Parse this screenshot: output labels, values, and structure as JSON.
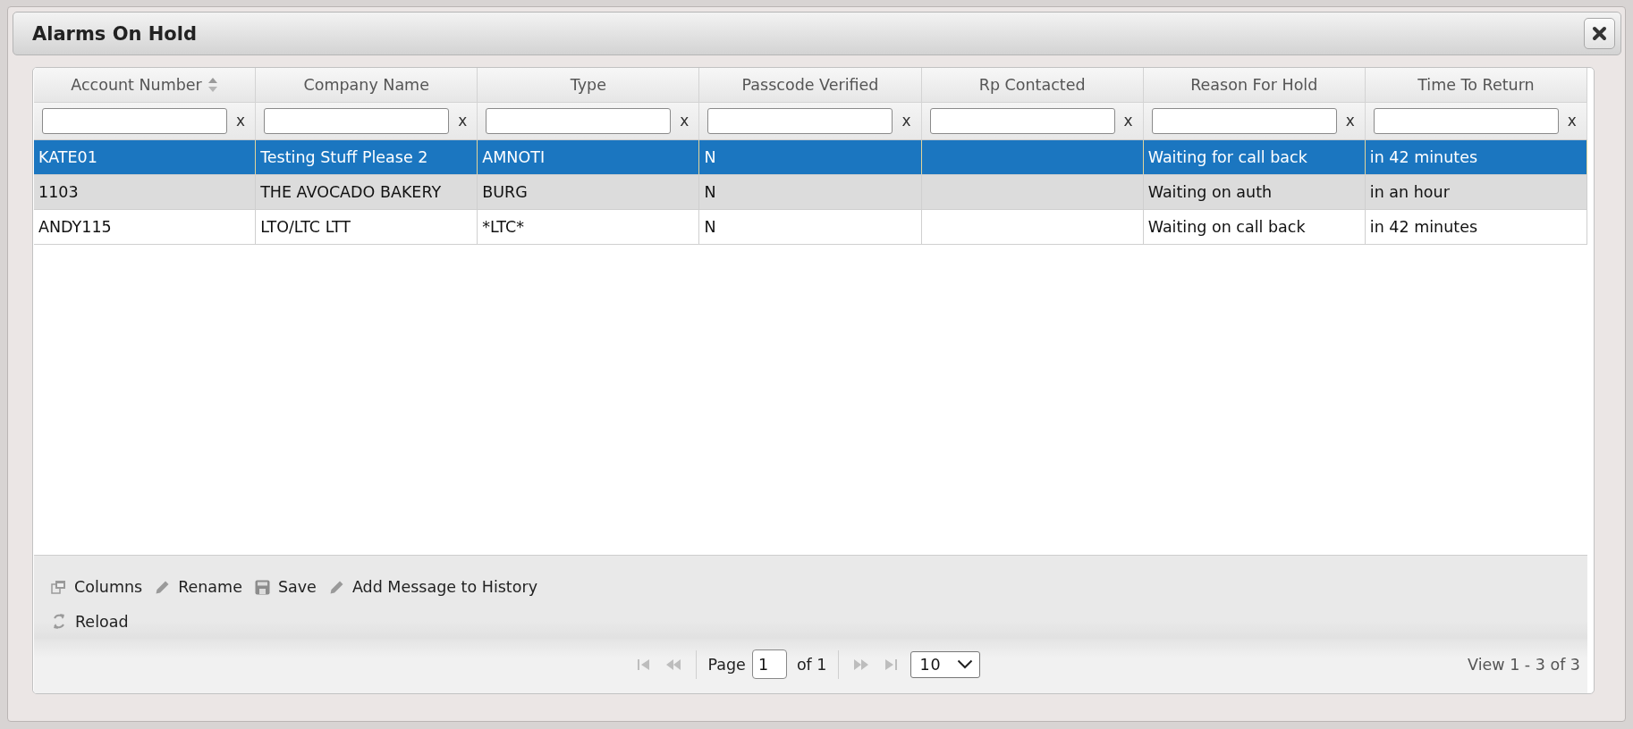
{
  "window": {
    "title": "Alarms On Hold"
  },
  "table": {
    "columns": [
      {
        "label": "Account Number",
        "sorted": true
      },
      {
        "label": "Company Name",
        "sorted": false
      },
      {
        "label": "Type",
        "sorted": false
      },
      {
        "label": "Passcode Verified",
        "sorted": false
      },
      {
        "label": "Rp Contacted",
        "sorted": false
      },
      {
        "label": "Reason For Hold",
        "sorted": false
      },
      {
        "label": "Time To Return",
        "sorted": false
      }
    ],
    "filters": [
      {
        "clear": "x"
      },
      {
        "clear": "x"
      },
      {
        "clear": "x"
      },
      {
        "clear": "x"
      },
      {
        "clear": "x"
      },
      {
        "clear": "x"
      },
      {
        "clear": "x"
      }
    ],
    "rows": [
      {
        "selected": true,
        "highlighted": false,
        "cells": [
          "KATE01",
          "Testing Stuff Please 2",
          "AMNOTI",
          "N",
          null,
          "Waiting for call back",
          "in 42 minutes"
        ]
      },
      {
        "selected": false,
        "highlighted": true,
        "cells": [
          "1103",
          "THE AVOCADO BAKERY",
          "BURG",
          "N",
          null,
          "Waiting on auth",
          "in an hour"
        ]
      },
      {
        "selected": false,
        "highlighted": false,
        "cells": [
          "ANDY115",
          "LTO/LTC LTT",
          "*LTC*",
          "N",
          null,
          "Waiting on call back",
          "in 42 minutes"
        ]
      }
    ]
  },
  "toolbar": {
    "rows": [
      {
        "buttons": [
          {
            "kind": "columns",
            "label": "Columns"
          },
          {
            "kind": "pencil",
            "label": "Rename"
          },
          {
            "kind": "save",
            "label": "Save"
          },
          {
            "kind": "pencil",
            "label": "Add Message to History"
          }
        ]
      },
      {
        "buttons": [
          {
            "kind": "reload",
            "label": "Reload"
          }
        ]
      }
    ]
  },
  "pager": {
    "back_buttons": [
      {
        "kind": "first",
        "disabled": true
      },
      {
        "kind": "prev",
        "disabled": true
      }
    ],
    "page_label": "Page",
    "page_value": "1",
    "page_count": "of 1",
    "forward_buttons": [
      {
        "kind": "next",
        "disabled": true
      },
      {
        "kind": "last",
        "disabled": true
      }
    ],
    "page_size": "10",
    "view_info": "View 1 - 3 of 3"
  }
}
